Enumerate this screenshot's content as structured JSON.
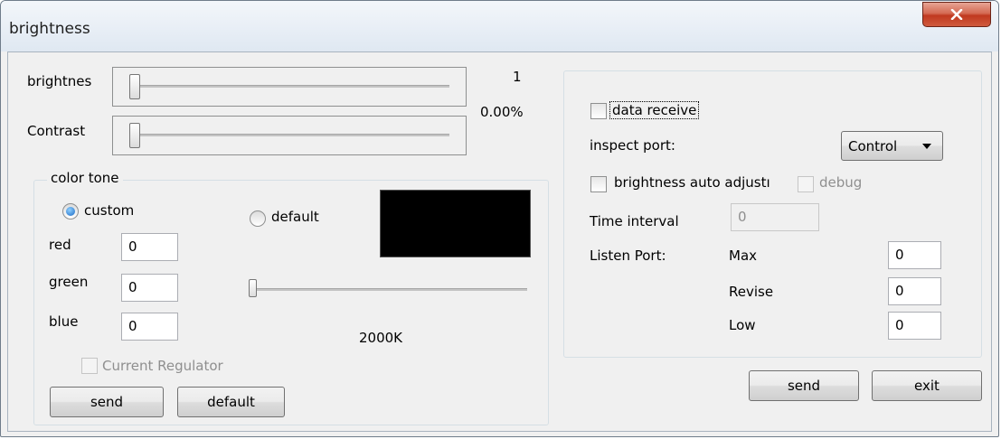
{
  "window": {
    "title": "brightness"
  },
  "sliders": {
    "brightness_label": "brightnes",
    "contrast_label": "Contrast",
    "brightness_value": "1",
    "percent_value": "0.00%"
  },
  "color_tone": {
    "caption": "color tone",
    "custom_label": "custom",
    "default_label": "default",
    "red_label": "red",
    "green_label": "green",
    "blue_label": "blue",
    "red_value": "0",
    "green_value": "0",
    "blue_value": "0",
    "temperature_value": "2000K",
    "preview_color": "#000000",
    "current_regulator_label": "Current Regulator",
    "send_label": "send",
    "default_button_label": "default"
  },
  "right_panel": {
    "data_receive_label": "data receive",
    "inspect_port_label": "inspect port:",
    "inspect_port_value": "Control",
    "auto_adjust_label": "brightness auto adjustı",
    "debug_label": "debug",
    "time_interval_label": "Time interval",
    "time_interval_value": "0",
    "listen_port_label": "Listen Port:",
    "max_label": "Max",
    "revise_label": "Revise",
    "low_label": "Low",
    "max_value": "0",
    "revise_value": "0",
    "low_value": "0",
    "send_label": "send",
    "exit_label": "exit"
  },
  "colors": {
    "close_button": "#c7432a",
    "preview_swatch": "#000000",
    "radio_selected": "#1a69c4"
  }
}
